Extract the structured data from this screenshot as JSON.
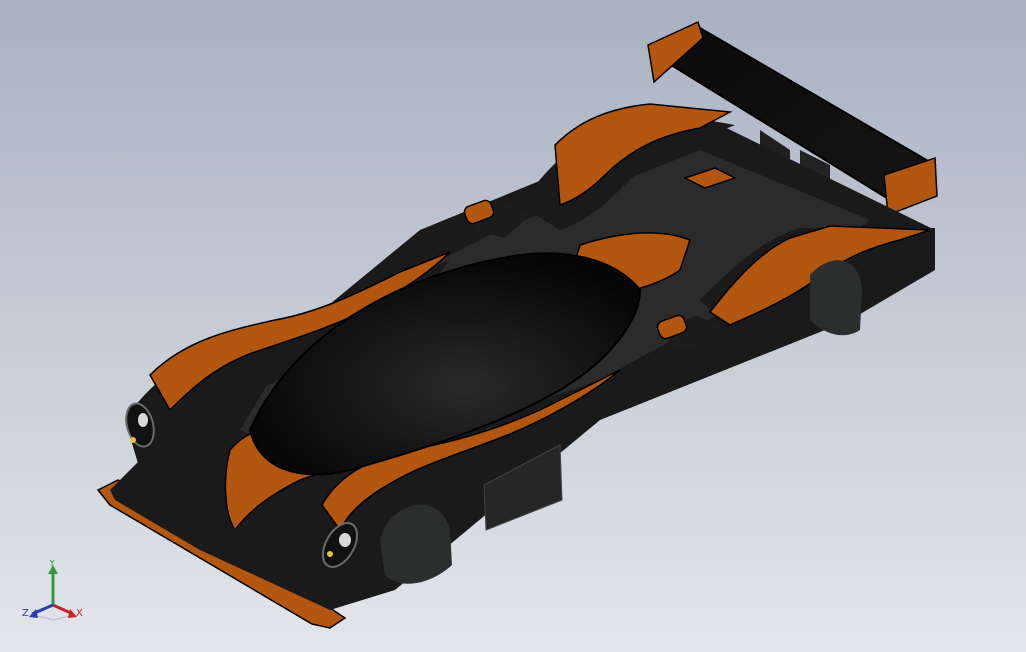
{
  "viewport": {
    "background_top": "#a9b1c1",
    "background_bottom": "#e3e6ea"
  },
  "model": {
    "body_color": "#1a1a1a",
    "panel_color": "#b35610",
    "panel_highlight": "#d96f1f",
    "canopy_color": "#0c0c0c",
    "wheel_well_color": "#2c2e2e",
    "lamp_color": "#d8d8d8",
    "indicator_color": "#e3c43a"
  },
  "triad": {
    "x_label": "X",
    "y_label": "Y",
    "z_label": "Z",
    "x_color": "#c8232b",
    "y_color": "#2f9a3a",
    "z_color": "#2b3cae"
  }
}
